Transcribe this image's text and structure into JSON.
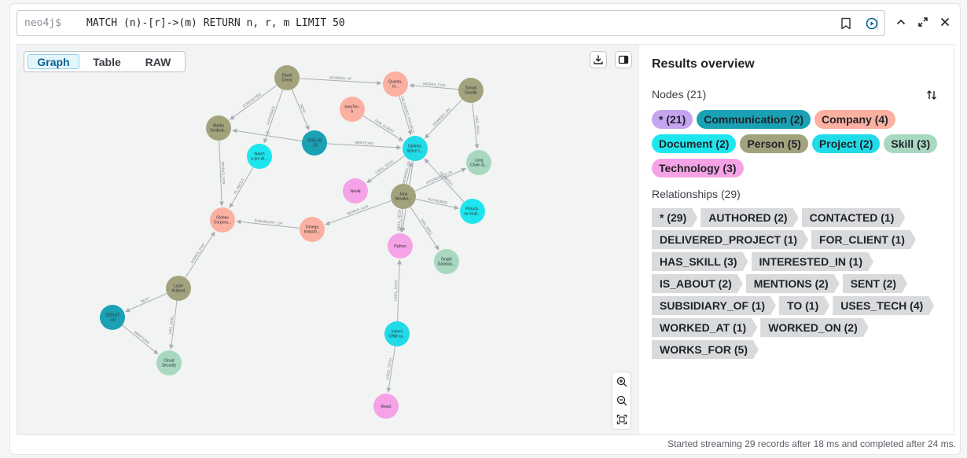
{
  "editor": {
    "prompt": "neo4j$",
    "query": "MATCH (n)-[r]->(m) RETURN n, r, m LIMIT 50"
  },
  "view_tabs": [
    "Graph",
    "Table",
    "RAW"
  ],
  "panel": {
    "title": "Results overview",
    "nodes_label": "Nodes (21)",
    "node_chips": [
      {
        "label": "* (21)",
        "color": "#c5a5f0"
      },
      {
        "label": "Communication (2)",
        "color": "#1aa1b4"
      },
      {
        "label": "Company (4)",
        "color": "#fcb0a2"
      },
      {
        "label": "Document (2)",
        "color": "#1ee6ef"
      },
      {
        "label": "Person (5)",
        "color": "#a2a27d"
      },
      {
        "label": "Project (2)",
        "color": "#22dbe8"
      },
      {
        "label": "Skill (3)",
        "color": "#a8d8c0"
      },
      {
        "label": "Technology (3)",
        "color": "#f6a2e6"
      }
    ],
    "rels_label": "Relationships (29)",
    "rel_chips": [
      "* (29)",
      "AUTHORED (2)",
      "CONTACTED (1)",
      "DELIVERED_PROJECT (1)",
      "FOR_CLIENT (1)",
      "HAS_SKILL (3)",
      "INTERESTED_IN (1)",
      "IS_ABOUT (2)",
      "MENTIONS (2)",
      "SENT (2)",
      "SUBSIDIARY_OF (1)",
      "TO (1)",
      "USES_TECH (4)",
      "WORKED_AT (1)",
      "WORKED_ON (2)",
      "WORKS_FOR (5)"
    ]
  },
  "graph": {
    "colors": {
      "person": "#a2a27d",
      "company": "#fcb0a2",
      "project": "#22dbe8",
      "communication": "#1aa1b4",
      "skill": "#a8d8c0",
      "technology": "#f6a2e6",
      "document": "#1ee6ef"
    },
    "nodes": [
      {
        "id": "pavel",
        "label": "Pavel\nČerný",
        "type": "person"
      },
      {
        "id": "quantum",
        "label": "Quantu-\nm...",
        "type": "company"
      },
      {
        "id": "tomas",
        "label": "Tomáš\nDvořák",
        "type": "person"
      },
      {
        "id": "innotech",
        "label": "InnoTec-\nh",
        "type": "company"
      },
      {
        "id": "martin",
        "label": "Martin\nSvobod...",
        "type": "person"
      },
      {
        "id": "comm1",
        "label": "2025-06\n-15",
        "type": "communication"
      },
      {
        "id": "optim",
        "label": "Optimiz-\nlizace c...",
        "type": "project"
      },
      {
        "id": "navrh",
        "label": "Návrh\na pro AI...",
        "type": "document"
      },
      {
        "id": "langchain",
        "label": "Lang\nChain &...",
        "type": "skill"
      },
      {
        "id": "neo4j",
        "label": "Neo4j",
        "type": "technology"
      },
      {
        "id": "jana",
        "label": "Jana\nNovako...",
        "type": "person"
      },
      {
        "id": "prirucka",
        "label": "Příručk-\nva studi...",
        "type": "document"
      },
      {
        "id": "globex",
        "label": "Globex\nCorpora...",
        "type": "company"
      },
      {
        "id": "omega",
        "label": "Omega\nIndustri...",
        "type": "company"
      },
      {
        "id": "python",
        "label": "Python",
        "type": "technology"
      },
      {
        "id": "graphdb",
        "label": "Graph\nDatabas...",
        "type": "skill"
      },
      {
        "id": "lucie",
        "label": "Lucie\nKrálová",
        "type": "person"
      },
      {
        "id": "comm2",
        "label": "2025-07\n-10",
        "type": "communication"
      },
      {
        "id": "cloud",
        "label": "Cloud\nSecurity",
        "type": "skill"
      },
      {
        "id": "interni",
        "label": "Interní\nCRM sy...",
        "type": "project"
      },
      {
        "id": "react",
        "label": "React",
        "type": "technology"
      }
    ],
    "edges": [
      {
        "from": "pavel",
        "to": "quantum",
        "label": "WORKED_AT"
      },
      {
        "from": "tomas",
        "to": "quantum",
        "label": "WORKS_FOR"
      },
      {
        "from": "pavel",
        "to": "martin",
        "label": "CONTACTED"
      },
      {
        "from": "pavel",
        "to": "comm1",
        "label": "SENT"
      },
      {
        "from": "pavel",
        "to": "navrh",
        "label": "AUTHORED"
      },
      {
        "from": "comm1",
        "to": "martin",
        "label": "TO"
      },
      {
        "from": "comm1",
        "to": "optim",
        "label": "MENTIONS"
      },
      {
        "from": "quantum",
        "to": "optim",
        "label": "DELIVERED_PROJECT"
      },
      {
        "from": "tomas",
        "to": "optim",
        "label": "WORKED_ON"
      },
      {
        "from": "tomas",
        "to": "langchain",
        "label": "HAS_SKILL"
      },
      {
        "from": "innotech",
        "to": "optim",
        "label": "FOR_CLIENT"
      },
      {
        "from": "optim",
        "to": "neo4j",
        "label": "USES_TECH"
      },
      {
        "from": "jana",
        "to": "optim",
        "label": "WORKED_ON"
      },
      {
        "from": "jana",
        "to": "langchain",
        "label": "INTERESTED_IN"
      },
      {
        "from": "jana",
        "to": "prirucka",
        "label": "AUTHORED"
      },
      {
        "from": "prirucka",
        "to": "optim",
        "label": "IS_ABOUT"
      },
      {
        "from": "jana",
        "to": "graphdb",
        "label": "HAS_SKILL"
      },
      {
        "from": "jana",
        "to": "omega",
        "label": "WORKS_FOR"
      },
      {
        "from": "jana",
        "to": "python",
        "label": "USES_TECH"
      },
      {
        "from": "optim",
        "to": "python",
        "label": "USES_TECH"
      },
      {
        "from": "martin",
        "to": "globex",
        "label": "WORKS_FOR"
      },
      {
        "from": "navrh",
        "to": "globex",
        "label": "IS_ABOUT"
      },
      {
        "from": "omega",
        "to": "globex",
        "label": "SUBSIDIARY_OF"
      },
      {
        "from": "lucie",
        "to": "globex",
        "label": "WORKS_FOR"
      },
      {
        "from": "lucie",
        "to": "comm2",
        "label": "SENT"
      },
      {
        "from": "lucie",
        "to": "cloud",
        "label": "HAS_SKILL"
      },
      {
        "from": "comm2",
        "to": "cloud",
        "label": "MENTIONS"
      },
      {
        "from": "interni",
        "to": "python",
        "label": "USES_TECH"
      },
      {
        "from": "interni",
        "to": "react",
        "label": "USES_TECH"
      }
    ]
  },
  "status": "Started streaming 29 records after 18 ms and completed after 24 ms."
}
